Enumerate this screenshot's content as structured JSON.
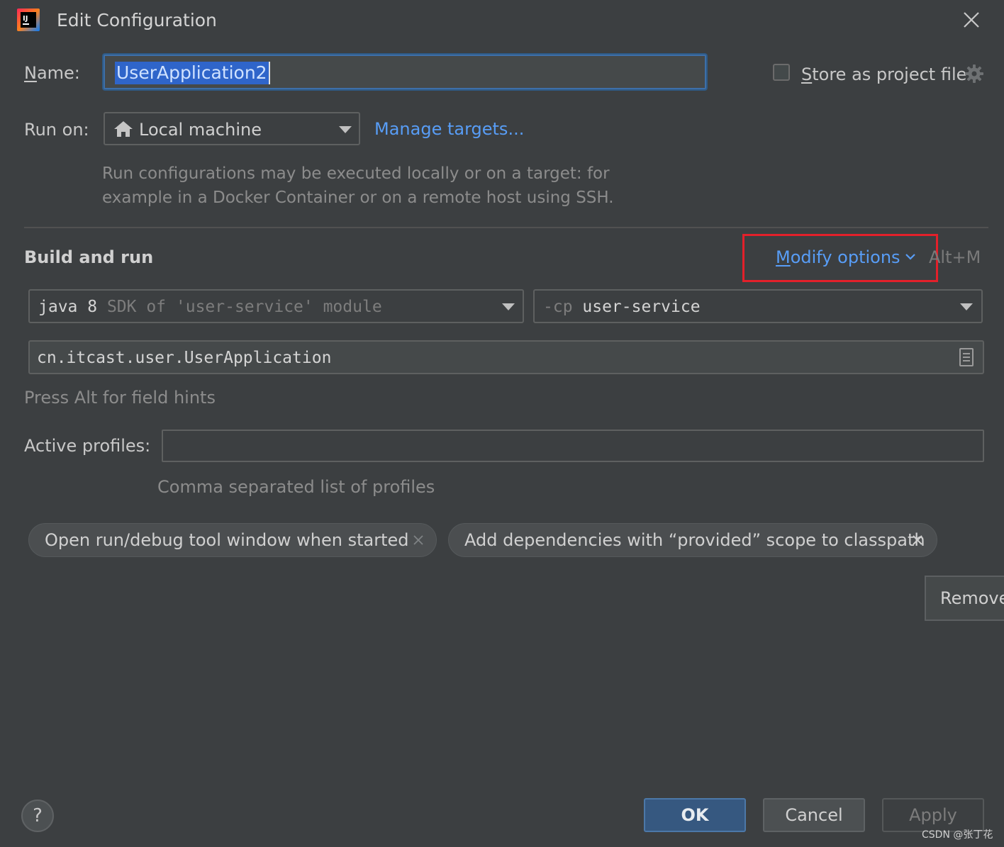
{
  "window": {
    "title": "Edit Configuration"
  },
  "name": {
    "label_mnemonic": "N",
    "label_rest": "ame:",
    "value": "UserApplication2"
  },
  "store": {
    "checked": false,
    "label_mnemonic": "S",
    "label_rest": "tore as project file"
  },
  "run_on": {
    "label": "Run on:",
    "selected": "Local machine",
    "manage_link": "Manage targets...",
    "hint_line1": "Run configurations may be executed locally or on a target: for",
    "hint_line2": "example in a Docker Container or on a remote host using SSH."
  },
  "build_and_run": {
    "title": "Build and run",
    "modify_mnemonic": "M",
    "modify_rest": "odify options",
    "shortcut": "Alt+M",
    "jdk": {
      "part1": "java 8",
      "part2": " SDK of 'user-service' module"
    },
    "classpath": {
      "prefix": "-cp",
      "value": " user-service"
    },
    "main_class": "cn.itcast.user.UserApplication",
    "field_hint": "Press Alt for field hints"
  },
  "profiles": {
    "label": "Active profiles:",
    "value": "",
    "hint": "Comma separated list of profiles"
  },
  "options_chips": [
    "Open run/debug tool window when started",
    "Add dependencies with “provided” scope to classpath"
  ],
  "tooltip_button": "Remove",
  "footer": {
    "ok": "OK",
    "cancel": "Cancel",
    "apply": "Apply",
    "help": "?"
  },
  "watermark": "CSDN @张丁花",
  "colors": {
    "background": "#3c3f41",
    "link": "#589df6",
    "highlight_box": "#e3202a",
    "ok_button": "#365880",
    "selection": "#2f65ca"
  }
}
